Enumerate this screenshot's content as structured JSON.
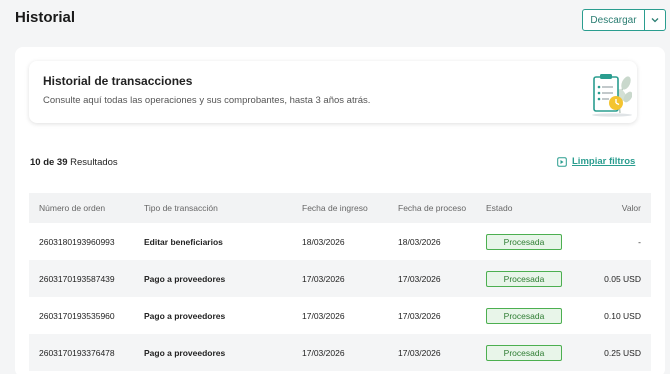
{
  "header": {
    "title": "Historial",
    "download_label": "Descargar"
  },
  "banner": {
    "title": "Historial de transacciones",
    "subtitle": "Consulte aquí todas las operaciones y sus comprobantes, hasta 3 años atrás.",
    "illustration": "clipboard-clock-illustration"
  },
  "results": {
    "shown": "10 de 39",
    "label": "Resultados"
  },
  "filters": {
    "clear_label": "Limpiar filtros"
  },
  "table": {
    "columns": [
      "Número de orden",
      "Tipo de transacción",
      "Fecha de ingreso",
      "Fecha de proceso",
      "Estado",
      "Valor"
    ],
    "rows": [
      {
        "order": "2603180193960993",
        "type": "Editar beneficiarios",
        "entry_date": "18/03/2026",
        "process_date": "18/03/2026",
        "status": "Procesada",
        "value": "-"
      },
      {
        "order": "2603170193587439",
        "type": "Pago a proveedores",
        "entry_date": "17/03/2026",
        "process_date": "17/03/2026",
        "status": "Procesada",
        "value": "0.05 USD"
      },
      {
        "order": "2603170193535960",
        "type": "Pago a proveedores",
        "entry_date": "17/03/2026",
        "process_date": "17/03/2026",
        "status": "Procesada",
        "value": "0.10 USD"
      },
      {
        "order": "2603170193376478",
        "type": "Pago a proveedores",
        "entry_date": "17/03/2026",
        "process_date": "17/03/2026",
        "status": "Procesada",
        "value": "0.25 USD"
      }
    ]
  },
  "colors": {
    "accent": "#2a9d8f",
    "status_border": "#4caf50",
    "status_bg": "#e8f5e9"
  }
}
